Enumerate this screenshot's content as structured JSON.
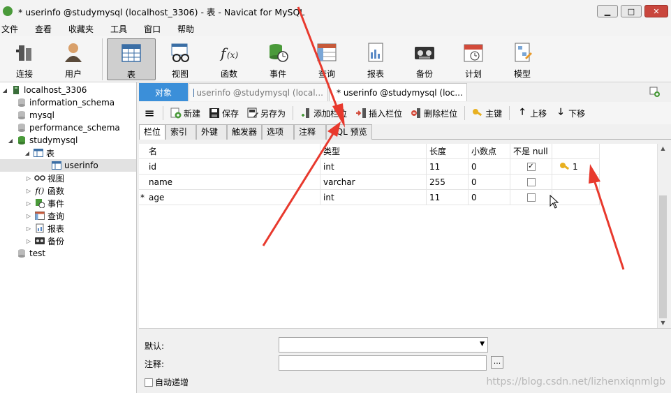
{
  "window": {
    "title": "* userinfo @studymysql (localhost_3306) - 表 - Navicat for MySQL",
    "min": "▁",
    "max": "□",
    "close": "✕"
  },
  "menu": [
    "文件",
    "查看",
    "收藏夹",
    "工具",
    "窗口",
    "帮助"
  ],
  "toolbar": [
    {
      "label": "连接",
      "icon": "connect-icon"
    },
    {
      "label": "用户",
      "icon": "user-icon"
    },
    {
      "label": "表",
      "icon": "table-icon",
      "active": true
    },
    {
      "label": "视图",
      "icon": "view-icon"
    },
    {
      "label": "函数",
      "icon": "function-icon"
    },
    {
      "label": "事件",
      "icon": "event-icon"
    },
    {
      "label": "查询",
      "icon": "query-icon"
    },
    {
      "label": "报表",
      "icon": "report-icon"
    },
    {
      "label": "备份",
      "icon": "backup-icon"
    },
    {
      "label": "计划",
      "icon": "schedule-icon"
    },
    {
      "label": "模型",
      "icon": "model-icon"
    }
  ],
  "tree": {
    "items": [
      {
        "label": "localhost_3306"
      },
      {
        "label": "information_schema"
      },
      {
        "label": "mysql"
      },
      {
        "label": "performance_schema"
      },
      {
        "label": "studymysql"
      },
      {
        "label": "表"
      },
      {
        "label": "userinfo"
      },
      {
        "label": "视图"
      },
      {
        "label": "函数"
      },
      {
        "label": "事件"
      },
      {
        "label": "查询"
      },
      {
        "label": "报表"
      },
      {
        "label": "备份"
      },
      {
        "label": "test"
      }
    ]
  },
  "tabs": {
    "objects": "对象",
    "tab1": "userinfo @studymysql (local...",
    "tab2": "* userinfo @studymysql (loc..."
  },
  "editor_toolbar": {
    "new": "新建",
    "save": "保存",
    "save_as": "另存为",
    "add_field": "添加栏位",
    "insert_field": "插入栏位",
    "delete_field": "删除栏位",
    "primary_key": "主键",
    "move_up": "上移",
    "move_down": "下移"
  },
  "subtabs": [
    "栏位",
    "索引",
    "外键",
    "触发器",
    "选项",
    "注释",
    "SQL 预览"
  ],
  "grid": {
    "headers": {
      "name": "名",
      "type": "类型",
      "length": "长度",
      "decimals": "小数点",
      "notnull": "不是 null"
    },
    "rows": [
      {
        "marker": "",
        "name": "id",
        "type": "int",
        "length": "11",
        "decimals": "0",
        "notnull": true,
        "key": "1"
      },
      {
        "marker": "",
        "name": "name",
        "type": "varchar",
        "length": "255",
        "decimals": "0",
        "notnull": false,
        "key": ""
      },
      {
        "marker": "*",
        "name": "age",
        "type": "int",
        "length": "11",
        "decimals": "0",
        "notnull": false,
        "key": ""
      }
    ]
  },
  "props": {
    "default_label": "默认:",
    "comment_label": "注释:",
    "auto_increment": "自动递增",
    "dots": "..."
  },
  "watermark": "https://blog.csdn.net/lizhenxiqnmlgb",
  "colors": {
    "accent": "#3b8fd9",
    "arrow": "#e8392d"
  }
}
